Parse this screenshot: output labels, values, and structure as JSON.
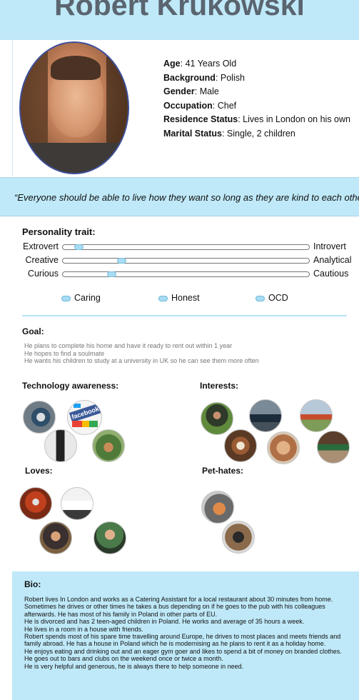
{
  "persona": {
    "name": "Robert Krukowski",
    "details": [
      {
        "label": "Age",
        "value": "41 Years Old"
      },
      {
        "label": "Background",
        "value": "Polish"
      },
      {
        "label": "Gender",
        "value": "Male"
      },
      {
        "label": "Occupation",
        "value": "Chef"
      },
      {
        "label": "Residence Status",
        "value": "Lives in London on his own"
      },
      {
        "label": "Marital Status",
        "value": "Single, 2 children"
      }
    ],
    "quote": "“Everyone should be able to live how they want so long as they are kind to each other"
  },
  "personality": {
    "title": "Personality trait:",
    "sliders": [
      {
        "left": "Extrovert",
        "right": "Introvert",
        "level": 0.05
      },
      {
        "left": "Creative",
        "right": "Analytical",
        "level": 0.23
      },
      {
        "left": "Curious",
        "right": "Cautious",
        "level": 0.19
      }
    ],
    "traits": [
      "Caring",
      "Honest",
      "OCD"
    ]
  },
  "goal": {
    "title": "Goal:",
    "lines": [
      "He plans to complete his home and have it ready to rent out within 1 year",
      "He hopes to find a soulmate",
      "He wants his children to study at a university in UK so he can see them more often"
    ]
  },
  "sections": {
    "technology": "Technology awareness:",
    "interests": "Interests:",
    "loves": "Loves:",
    "pet_hates": "Pet-hates:"
  },
  "tech_logo_text": "facebook",
  "bio": {
    "title": "Bio:",
    "lines": [
      "Robert lives In London and works as a Catering Assistant for a local restaurant about 30 minutes from home. Sometimes he drives or other times he takes a bus depending on if he goes to the pub with his colleagues afterwards. He has most of his family in Poland in other parts of EU.",
      "He is divorced and has 2 teen-aged children in Poland. He works and average of 35 hours a week.",
      "He lives in a room in a house with friends.",
      "Robert spends most of his spare time travelling around Europe, he drives to most places and meets friends and family abroad. He has a house in Poland which he is modernising as he plans to rent it as a holiday home.",
      "He enjoys eating and drinking out and an eager gym goer and likes to spend a bit of money on branded clothes.",
      "He goes out to bars and clubs on the weekend once or twice a month.",
      "He is very helpful and generous, he is always there to help someone in need."
    ]
  }
}
